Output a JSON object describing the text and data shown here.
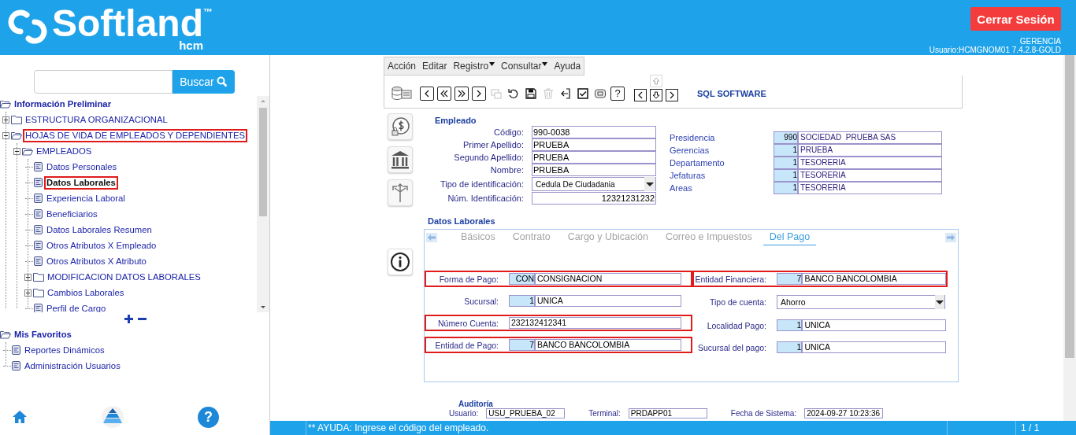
{
  "header": {
    "brand": "Softland",
    "trademark": "™",
    "product": "hcm",
    "logout": "Cerrar Sesión",
    "profile": "GERENCIA",
    "user": "Usuario:HCMGNOM01 7.4.2.8-GOLD"
  },
  "sidebar": {
    "search_button": "Buscar",
    "tree": [
      {
        "label": "Información Preliminar",
        "kind": "section",
        "expanded": true,
        "highlighted": false,
        "children": [
          {
            "label": "ESTRUCTURA ORGANIZACIONAL",
            "kind": "folder",
            "expanded": false,
            "highlighted": false
          },
          {
            "label": "HOJAS DE VIDA DE EMPLEADOS Y DEPENDIENTES",
            "kind": "folder",
            "expanded": true,
            "highlighted": true,
            "children": [
              {
                "label": "EMPLEADOS",
                "kind": "folder",
                "expanded": true,
                "highlighted": false,
                "children": [
                  {
                    "label": "Datos Personales",
                    "kind": "page",
                    "selected": false,
                    "highlighted": false
                  },
                  {
                    "label": "Datos Laborales",
                    "kind": "page",
                    "selected": true,
                    "highlighted": true
                  },
                  {
                    "label": "Experiencia Laboral",
                    "kind": "page",
                    "selected": false,
                    "highlighted": false
                  },
                  {
                    "label": "Beneficiarios",
                    "kind": "page",
                    "selected": false,
                    "highlighted": false
                  },
                  {
                    "label": "Datos Laborales Resumen",
                    "kind": "page",
                    "selected": false,
                    "highlighted": false
                  },
                  {
                    "label": "Otros Atributos X Empleado",
                    "kind": "page",
                    "selected": false,
                    "highlighted": false
                  },
                  {
                    "label": "Otros Atributos X Atributo",
                    "kind": "page",
                    "selected": false,
                    "highlighted": false
                  },
                  {
                    "label": "MODIFICACION DATOS LABORALES",
                    "kind": "folder",
                    "expanded": false,
                    "highlighted": false
                  },
                  {
                    "label": "Cambios Laborales",
                    "kind": "folder",
                    "expanded": false,
                    "highlighted": false
                  },
                  {
                    "label": "Perfil de Cargo",
                    "kind": "page",
                    "selected": false,
                    "highlighted": false
                  }
                ]
              }
            ]
          }
        ]
      }
    ],
    "favorites": [
      {
        "label": "Mis Favoritos",
        "kind": "section",
        "expanded": true,
        "highlighted": false,
        "children": [
          {
            "label": "Reportes Dinámicos",
            "kind": "page",
            "selected": false,
            "highlighted": false
          },
          {
            "label": "Administración Usuarios",
            "kind": "page",
            "selected": false,
            "highlighted": false
          }
        ]
      }
    ],
    "help_glyph": "?"
  },
  "form": {
    "menu": [
      {
        "label": "Acción",
        "dropdown": false
      },
      {
        "label": "Editar",
        "dropdown": false
      },
      {
        "label": "Registro",
        "dropdown": true
      },
      {
        "label": "Consultar",
        "dropdown": true
      },
      {
        "label": "Ayuda",
        "dropdown": false
      }
    ],
    "toolbar": [
      {
        "kind": "database",
        "disabled": false
      },
      {
        "kind": "previous",
        "disabled": false
      },
      {
        "kind": "first",
        "disabled": false
      },
      {
        "kind": "last",
        "disabled": false
      },
      {
        "kind": "next",
        "disabled": false
      },
      {
        "kind": "duplicate",
        "disabled": true
      },
      {
        "kind": "undo",
        "disabled": false
      },
      {
        "kind": "save",
        "disabled": false
      },
      {
        "kind": "delete",
        "disabled": true
      },
      {
        "kind": "exit",
        "disabled": false
      },
      {
        "kind": "approve",
        "disabled": false
      },
      {
        "kind": "print",
        "disabled": false
      },
      {
        "kind": "help",
        "disabled": false,
        "text": "?"
      }
    ],
    "arrows": [
      {
        "kind": "up",
        "disabled": true
      },
      {
        "kind": "left",
        "disabled": false
      },
      {
        "kind": "down",
        "disabled": false
      },
      {
        "kind": "right",
        "disabled": false
      }
    ],
    "company": "SQL SOFTWARE",
    "employee": {
      "title": "Empleado",
      "fields": [
        {
          "label": "Código:",
          "value": "990-0038",
          "kind": "text"
        },
        {
          "label": "Primer Apellido:",
          "value": "PRUEBA",
          "kind": "text"
        },
        {
          "label": "Segundo Apellido:",
          "value": "PRUEBA",
          "kind": "text"
        },
        {
          "label": "Nombre:",
          "value": "PRUEBA",
          "kind": "text"
        },
        {
          "label": "Tipo de identificación:",
          "value": "Cedula De Ciudadania",
          "kind": "select"
        },
        {
          "label": "Núm. Identificación:",
          "value": "12321231232",
          "kind": "number"
        }
      ]
    },
    "organization": [
      {
        "label": "Presidencia",
        "code": "990",
        "name": "SOCIEDAD  PRUEBA SAS"
      },
      {
        "label": "Gerencias",
        "code": "1",
        "name": "PRUEBA"
      },
      {
        "label": "Departamento",
        "code": "1",
        "name": "TESORERIA"
      },
      {
        "label": "Jefaturas",
        "code": "1",
        "name": "TESORERIA"
      },
      {
        "label": "Areas",
        "code": "1",
        "name": "TESORERIA"
      }
    ],
    "labor": {
      "title": "Datos Laborales",
      "tabs": [
        {
          "label": "Básicos",
          "selected": false
        },
        {
          "label": "Contrato",
          "selected": false
        },
        {
          "label": "Cargo y Ubicación",
          "selected": false
        },
        {
          "label": "Correo e Impuestos",
          "selected": false
        },
        {
          "label": "Del Pago",
          "selected": true
        }
      ],
      "left_fields": [
        {
          "label": "Forma de Pago:",
          "code": "CON",
          "value": "CONSIGNACION",
          "kind": "coded",
          "highlighted": true
        },
        {
          "label": "Sucursal:",
          "code": "1",
          "value": "UNICA",
          "kind": "coded",
          "highlighted": false
        },
        {
          "label": "Número Cuenta:",
          "value": "232132412341",
          "kind": "plain",
          "highlighted": true
        },
        {
          "label": "Entidad de Pago:",
          "code": "7",
          "value": "BANCO BANCOLOMBIA",
          "kind": "coded",
          "highlighted": true
        }
      ],
      "right_fields": [
        {
          "label": "Entidad Financiera:",
          "code": "7",
          "value": "BANCO BANCOLOMBIA",
          "kind": "coded",
          "highlighted": true
        },
        {
          "label": "Tipo de cuenta:",
          "value": "Ahorro",
          "kind": "select",
          "highlighted": false
        },
        {
          "label": "Localidad Pago:",
          "code": "1",
          "value": "UNICA",
          "kind": "coded",
          "highlighted": false
        },
        {
          "label": "Sucursal del pago:",
          "code": "1",
          "value": "UNICA",
          "kind": "coded",
          "highlighted": false
        }
      ]
    },
    "audit": {
      "title": "Auditoría",
      "fields": [
        {
          "label": "Usuario:",
          "value": "USU_PRUEBA_02"
        },
        {
          "label": "Terminal:",
          "value": "PRDAPP01"
        },
        {
          "label": "Fecha de Sistema:",
          "value": "2024-09-27 10:23:36"
        }
      ]
    }
  },
  "status_bar": {
    "message": "** AYUDA: Ingrese el código del empleado.",
    "pages": "1 / 1"
  }
}
